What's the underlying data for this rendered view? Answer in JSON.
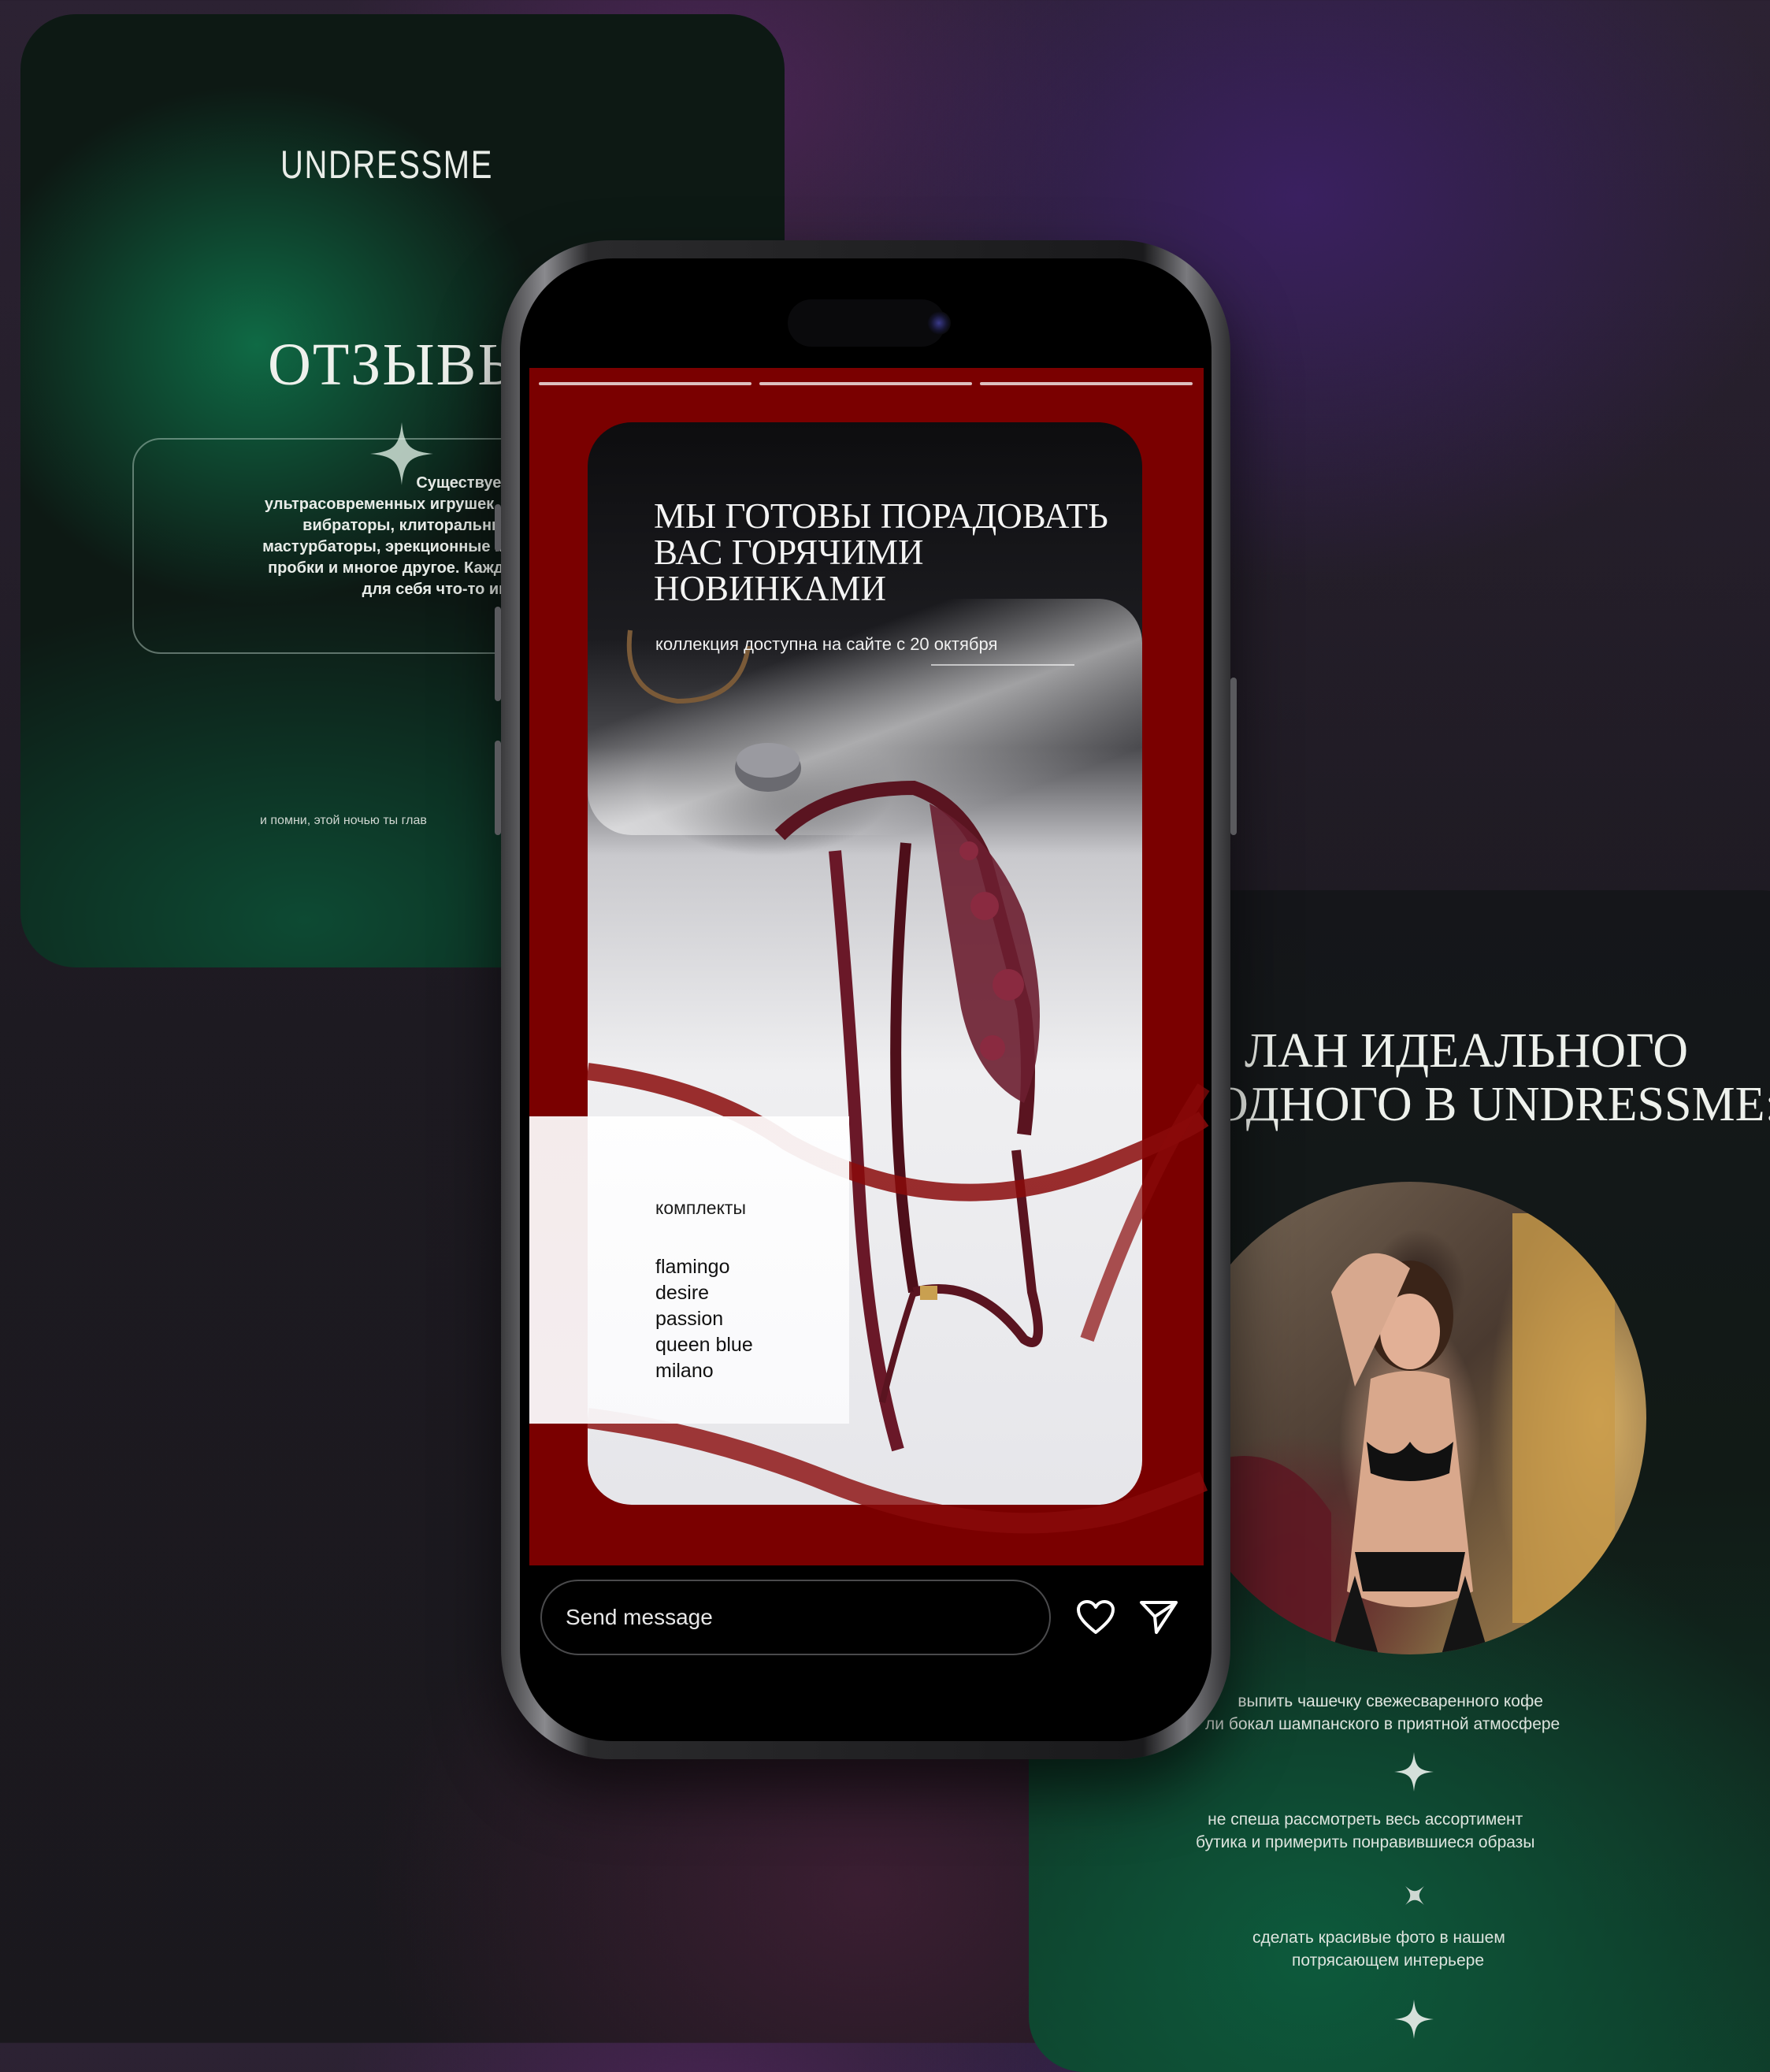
{
  "left_card": {
    "logo": "UNDRESSME",
    "title": "ОТЗЫВЫ",
    "review_lines": [
      "Существует огромное колич",
      "ультрасовременных игрушек. Игру",
      "вибраторы, клиторальные стим",
      "мастурбаторы, эрекционные кольц",
      "пробки и многое другое. Каждая п",
      "для себя что-то интерес"
    ],
    "footer": "и помни, этой ночью ты глав"
  },
  "story": {
    "title_lines": [
      "МЫ ГОТОВЫ ПОРАДОВАТЬ",
      "ВАС ГОРЯЧИМИ",
      "НОВИНКАМИ"
    ],
    "subtitle": "коллекция доступна на сайте с 20 октября",
    "kits_label": "комплекты",
    "kits": [
      "flamingo",
      "desire",
      "passion",
      "queen blue",
      "milano"
    ],
    "progress_segments": 3
  },
  "composer": {
    "placeholder": "Send message",
    "like_icon": "heart-icon",
    "send_icon": "send-icon"
  },
  "right_card": {
    "title_lines": [
      "ЛАН ИДЕАЛЬНОГО",
      "ОДНОГО В UNDRESSME:"
    ],
    "items": [
      [
        "выпить чашечку свежесваренного кофе",
        "ли бокал шампанского в приятной атмосфере"
      ],
      [
        "не спеша рассмотреть весь ассортимент",
        "бутика и примерить понравившиеся образы"
      ],
      [
        "сделать красивые фото в нашем",
        "потрясающем интерьере"
      ]
    ]
  },
  "colors": {
    "story_red": "#7a0000",
    "card_green": "#0f6a45",
    "background": "#1d1a21"
  }
}
